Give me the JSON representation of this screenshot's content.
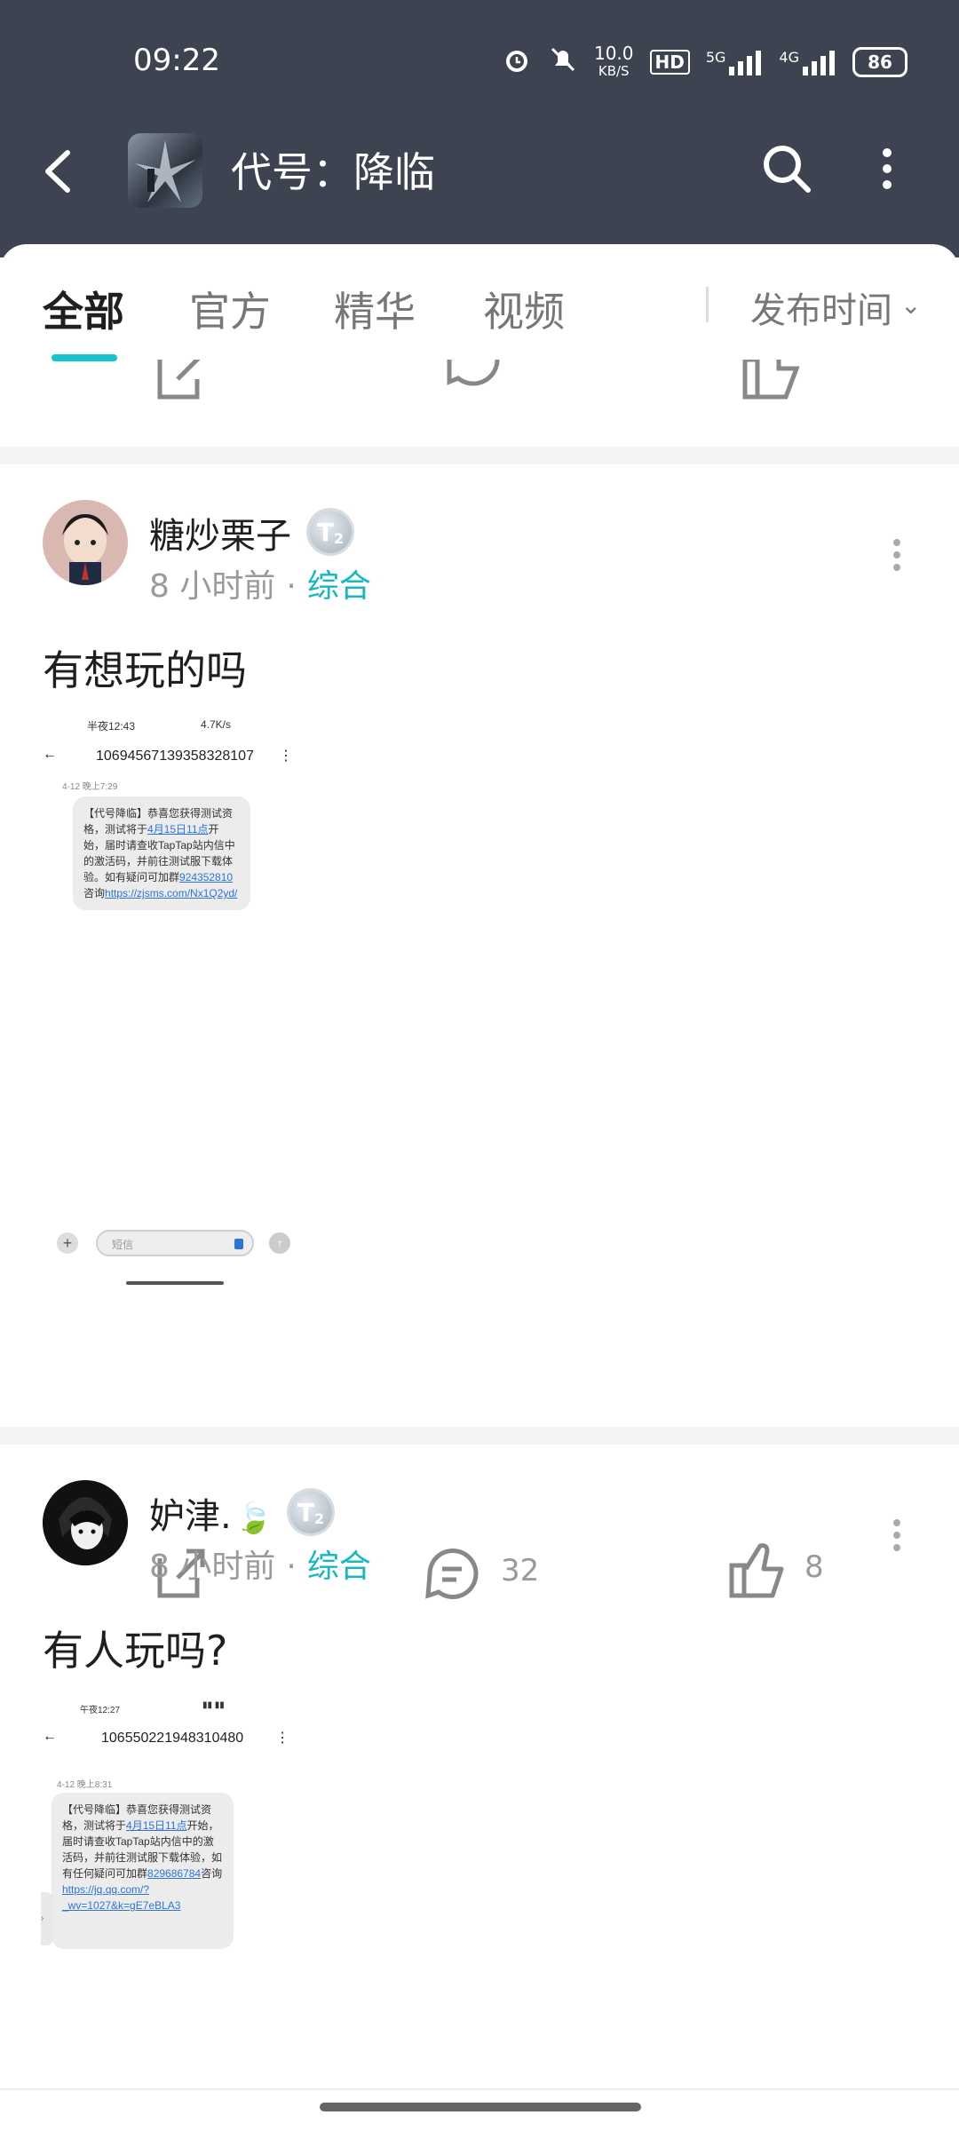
{
  "status_bar": {
    "time": "09:22",
    "net_speed_value": "10.0",
    "net_speed_unit": "KB/S",
    "hd_label": "HD",
    "net_5g": "5G",
    "net_4g": "4G",
    "battery": "86"
  },
  "header": {
    "title": "代号：降临"
  },
  "tabs": [
    {
      "label": "全部"
    },
    {
      "label": "官方"
    },
    {
      "label": "精华"
    },
    {
      "label": "视频"
    }
  ],
  "sort": {
    "label": "发布时间"
  },
  "posts": [
    {
      "username": "糖炒栗子",
      "badge": "T",
      "badge_level": "2",
      "time": "8 小时前",
      "category": "综合",
      "text": "有想玩的吗",
      "screenshot": {
        "status_left": "半夜12:43",
        "status_right": "4.7K/s",
        "number": "10694567139358328107",
        "date": "4-12 晚上7:29",
        "message_1": "【代号降临】恭喜您获得测试资格，测试将于",
        "message_link_1": "4月15日11点",
        "message_2": "开始，届时请查收TapTap站内信中的激活码，并前往测试服下载体验。如有疑问可加群",
        "message_link_2": "924352810",
        "message_3": "咨询",
        "message_link_3": "https://zjsms.com/Nx1Q2yd/",
        "input_placeholder": "短信"
      },
      "comments": "32",
      "likes": "8"
    },
    {
      "username": "妒津.",
      "badge": "T",
      "badge_level": "2",
      "time": "8 小时前",
      "category": "综合",
      "text": "有人玩吗?",
      "screenshot": {
        "status_left": "午夜12:27",
        "number": "106550221948310480",
        "date": "4-12 晚上8:31",
        "message_1": "【代号降临】恭喜您获得测试资格，测试将于",
        "message_link_1": "4月15日11点",
        "message_2": "开始，届时请查收TapTap站内信中的激活码，并前往测试服下载体验，如有任何疑问可加群",
        "message_link_2": "829686784",
        "message_3": "咨询",
        "message_link_3": "https://jq.qq.com/?_wv=1027&k=gE7eBLA3"
      }
    }
  ]
}
